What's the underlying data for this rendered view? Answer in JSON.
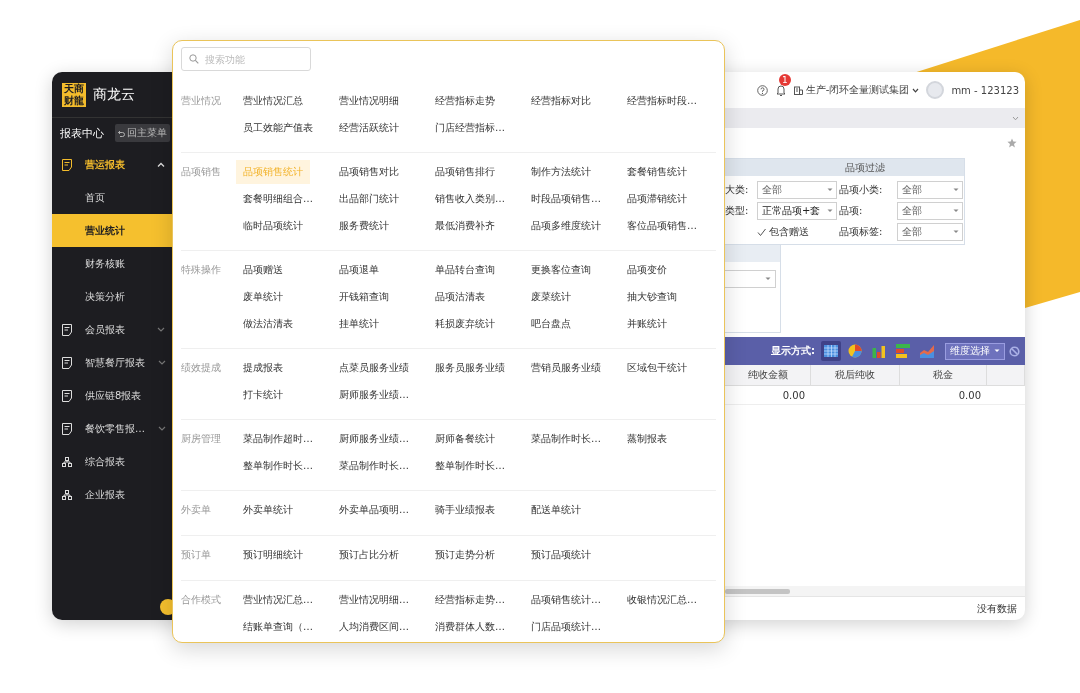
{
  "sidebar": {
    "logo_mark": "天商财龍",
    "brand": "商龙云",
    "section_title": "报表中心",
    "back_button": "回主菜单",
    "menu": [
      {
        "kind": "report",
        "label": "营运报表",
        "selected": true,
        "expanded": true,
        "children": [
          {
            "label": "首页",
            "selected": false
          },
          {
            "label": "营业统计",
            "selected": true
          },
          {
            "label": "财务核账",
            "selected": false
          },
          {
            "label": "决策分析",
            "selected": false
          }
        ]
      },
      {
        "kind": "report",
        "label": "会员报表",
        "selected": false,
        "expanded": false
      },
      {
        "kind": "report",
        "label": "智慧餐厅报表",
        "selected": false,
        "expanded": false
      },
      {
        "kind": "report",
        "label": "供应链8报表",
        "selected": false
      },
      {
        "kind": "report",
        "label": "餐饮零售报…",
        "selected": false,
        "expanded": false
      },
      {
        "kind": "org",
        "label": "综合报表",
        "selected": false
      },
      {
        "kind": "org",
        "label": "企业报表",
        "selected": false
      }
    ]
  },
  "header": {
    "notification_count": "1",
    "organization": "生产-闭环全量测试集团",
    "user": "mm - 123123"
  },
  "filter_panel": {
    "title": "品项过滤",
    "fields": [
      {
        "kind": "select",
        "label": "大类:",
        "value": "全部"
      },
      {
        "kind": "select",
        "label": "品项小类:",
        "value": "全部"
      },
      {
        "kind": "select",
        "label": "类型:",
        "value": "正常品项+套"
      },
      {
        "kind": "select",
        "label": "品项:",
        "value": "全部"
      },
      {
        "kind": "checkbox",
        "label": "包含赠送",
        "checked": true
      },
      {
        "kind": "select",
        "label": "品项标签:",
        "value": "全部"
      }
    ]
  },
  "toolbar": {
    "label": "显示方式:",
    "views": [
      {
        "kind": "table",
        "selected": true
      },
      {
        "kind": "pie",
        "selected": false
      },
      {
        "kind": "bar",
        "selected": false
      },
      {
        "kind": "hbar",
        "selected": false
      },
      {
        "kind": "area",
        "selected": false
      }
    ],
    "dimension_button": "维度选择"
  },
  "table": {
    "columns": [
      "纯收金额",
      "税后纯收",
      "税金"
    ],
    "rows": [
      {
        "cells": [
          "0.00",
          null,
          "0.00"
        ]
      }
    ]
  },
  "footer": "没有数据",
  "popup": {
    "search": {
      "placeholder": "搜索功能"
    },
    "sections": [
      {
        "label": "营业情况",
        "items": [
          {
            "label": "营业情况汇总",
            "selected": false
          },
          {
            "label": "营业情况明细",
            "selected": false
          },
          {
            "label": "经营指标走势",
            "selected": false
          },
          {
            "label": "经营指标对比",
            "selected": false
          },
          {
            "label": "经营指标时段…",
            "selected": false
          },
          {
            "label": "员工效能产值表",
            "selected": false
          },
          {
            "label": "经营活跃统计",
            "selected": false
          },
          {
            "label": "门店经营指标…",
            "selected": false
          }
        ]
      },
      {
        "label": "品项销售",
        "items": [
          {
            "label": "品项销售统计",
            "selected": true
          },
          {
            "label": "品项销售对比",
            "selected": false
          },
          {
            "label": "品项销售排行",
            "selected": false
          },
          {
            "label": "制作方法统计",
            "selected": false
          },
          {
            "label": "套餐销售统计",
            "selected": false
          },
          {
            "label": "套餐明细组合…",
            "selected": false
          },
          {
            "label": "出品部门统计",
            "selected": false
          },
          {
            "label": "销售收入类别…",
            "selected": false
          },
          {
            "label": "时段品项销售…",
            "selected": false
          },
          {
            "label": "品项滞销统计",
            "selected": false
          },
          {
            "label": "临时品项统计",
            "selected": false
          },
          {
            "label": "服务费统计",
            "selected": false
          },
          {
            "label": "最低消费补齐",
            "selected": false
          },
          {
            "label": "品项多维度统计",
            "selected": false
          },
          {
            "label": "客位品项销售…",
            "selected": false
          }
        ]
      },
      {
        "label": "特殊操作",
        "items": [
          {
            "label": "品项赠送",
            "selected": false
          },
          {
            "label": "品项退单",
            "selected": false
          },
          {
            "label": "单品转台查询",
            "selected": false
          },
          {
            "label": "更换客位查询",
            "selected": false
          },
          {
            "label": "品项变价",
            "selected": false
          },
          {
            "label": "废单统计",
            "selected": false
          },
          {
            "label": "开钱箱查询",
            "selected": false
          },
          {
            "label": "品项沽清表",
            "selected": false
          },
          {
            "label": "废菜统计",
            "selected": false
          },
          {
            "label": "抽大钞查询",
            "selected": false
          },
          {
            "label": "做法沽清表",
            "selected": false
          },
          {
            "label": "挂单统计",
            "selected": false
          },
          {
            "label": "耗损废弃统计",
            "selected": false
          },
          {
            "label": "吧台盘点",
            "selected": false
          },
          {
            "label": "并账统计",
            "selected": false
          }
        ]
      },
      {
        "label": "绩效提成",
        "items": [
          {
            "label": "提成报表",
            "selected": false
          },
          {
            "label": "点菜员服务业绩",
            "selected": false
          },
          {
            "label": "服务员服务业绩",
            "selected": false
          },
          {
            "label": "营销员服务业绩",
            "selected": false
          },
          {
            "label": "区域包干统计",
            "selected": false
          },
          {
            "label": "打卡统计",
            "selected": false
          },
          {
            "label": "厨师服务业绩…",
            "selected": false
          }
        ]
      },
      {
        "label": "厨房管理",
        "items": [
          {
            "label": "菜品制作超时…",
            "selected": false
          },
          {
            "label": "厨师服务业绩…",
            "selected": false
          },
          {
            "label": "厨师备餐统计",
            "selected": false
          },
          {
            "label": "菜品制作时长…",
            "selected": false
          },
          {
            "label": "蒸制报表",
            "selected": false
          },
          {
            "label": "整单制作时长…",
            "selected": false
          },
          {
            "label": "菜品制作时长…",
            "selected": false
          },
          {
            "label": "整单制作时长…",
            "selected": false
          }
        ]
      },
      {
        "label": "外卖单",
        "items": [
          {
            "label": "外卖单统计",
            "selected": false
          },
          {
            "label": "外卖单品项明…",
            "selected": false
          },
          {
            "label": "骑手业绩报表",
            "selected": false
          },
          {
            "label": "配送单统计",
            "selected": false
          }
        ]
      },
      {
        "label": "预订单",
        "items": [
          {
            "label": "预订明细统计",
            "selected": false
          },
          {
            "label": "预订占比分析",
            "selected": false
          },
          {
            "label": "预订走势分析",
            "selected": false
          },
          {
            "label": "预订品项统计",
            "selected": false
          }
        ]
      },
      {
        "label": "合作模式",
        "items": [
          {
            "label": "营业情况汇总…",
            "selected": false
          },
          {
            "label": "营业情况明细…",
            "selected": false
          },
          {
            "label": "经营指标走势…",
            "selected": false
          },
          {
            "label": "品项销售统计…",
            "selected": false
          },
          {
            "label": "收银情况汇总…",
            "selected": false
          },
          {
            "label": "结账单查询（…",
            "selected": false
          },
          {
            "label": "人均消费区间…",
            "selected": false
          },
          {
            "label": "消费群体人数…",
            "selected": false
          },
          {
            "label": "门店品项统计…",
            "selected": false
          }
        ]
      }
    ]
  }
}
